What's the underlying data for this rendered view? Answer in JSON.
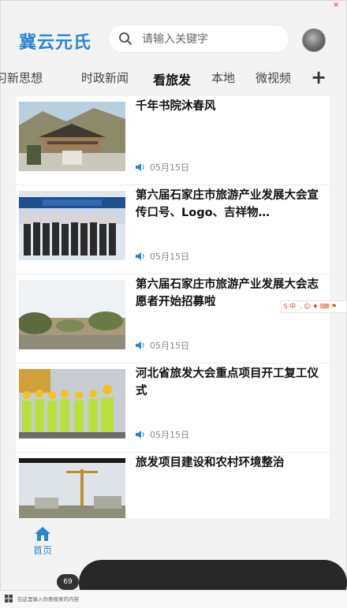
{
  "header": {
    "logo": "冀云元氏",
    "search_placeholder": "请输入关键字"
  },
  "tabs": [
    {
      "label": "习新思想"
    },
    {
      "label": "时政新闻"
    },
    {
      "label": "看旅发",
      "active": true
    },
    {
      "label": "本地"
    },
    {
      "label": "微视频"
    }
  ],
  "tab_add": "+",
  "news": [
    {
      "title": "千年书院沐春风",
      "date": "05月15日"
    },
    {
      "title": "第六届石家庄市旅游产业发展大会宣传口号、Logo、吉祥物…",
      "date": "05月15日"
    },
    {
      "title": "第六届石家庄市旅游产业发展大会志愿者开始招募啦",
      "date": "05月15日"
    },
    {
      "title": "河北省旅发大会重点项目开工复工仪式",
      "date": "05月15日"
    },
    {
      "title": "旅发项目建设和农村环境整治",
      "date": ""
    }
  ],
  "bottom_nav": {
    "home_label": "首页"
  },
  "taskbar": {
    "search_text": "在这里输入你要搜索的内容",
    "badge": "69"
  },
  "colors": {
    "accent": "#2a86d6"
  }
}
